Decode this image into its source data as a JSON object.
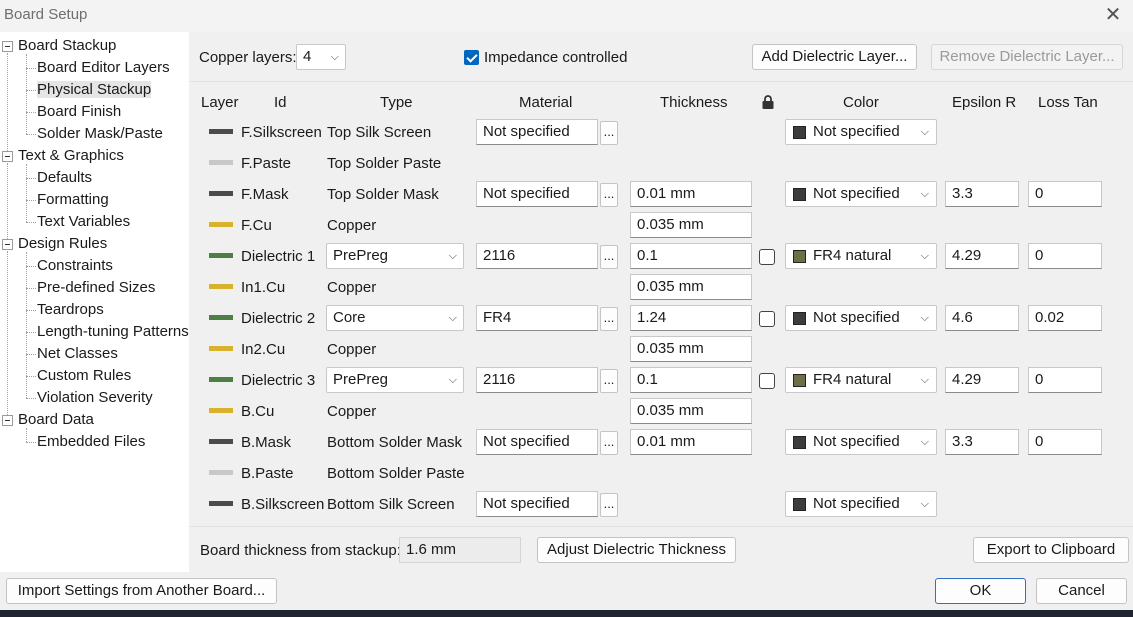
{
  "window": {
    "title": "Board Setup",
    "close_glyph": "✕"
  },
  "tree": {
    "groups": [
      {
        "label": "Board Stackup",
        "children": [
          "Board Editor Layers",
          "Physical Stackup",
          "Board Finish",
          "Solder Mask/Paste"
        ]
      },
      {
        "label": "Text & Graphics",
        "children": [
          "Defaults",
          "Formatting",
          "Text Variables"
        ]
      },
      {
        "label": "Design Rules",
        "children": [
          "Constraints",
          "Pre-defined Sizes",
          "Teardrops",
          "Length-tuning Patterns",
          "Net Classes",
          "Custom Rules",
          "Violation Severity"
        ]
      },
      {
        "label": "Board Data",
        "children": [
          "Embedded Files"
        ]
      }
    ],
    "selected": "Physical Stackup"
  },
  "toolbar": {
    "copper_layers_label": "Copper layers:",
    "copper_layers_value": "4",
    "impedance_label": "Impedance controlled",
    "impedance_checked": true,
    "add_dielectric": "Add Dielectric Layer...",
    "remove_dielectric": "Remove Dielectric Layer..."
  },
  "columns": {
    "layer": "Layer",
    "id": "Id",
    "type": "Type",
    "material": "Material",
    "thickness": "Thickness",
    "lock_icon": "lock-icon",
    "color": "Color",
    "epsilon": "Epsilon R",
    "loss": "Loss Tan"
  },
  "colors": {
    "silk": "#4b4b4b",
    "paste": "#c8c8c8",
    "mask": "#4b4b4b",
    "copper": "#d8b22a",
    "dielectric": "#4f7e45",
    "not_specified_swatch": "#3c3c3c",
    "fr4_swatch": "#6f6f45"
  },
  "rows": [
    {
      "swatch": "silk",
      "id": "F.Silkscreen",
      "type": "Top Silk Screen",
      "type_combo": false,
      "material": "Not specified",
      "thickness": "",
      "lock": false,
      "color": "Not specified",
      "color_swatch": "not_specified_swatch",
      "epsilon": "",
      "loss": ""
    },
    {
      "swatch": "paste",
      "id": "F.Paste",
      "type": "Top Solder Paste",
      "type_combo": false,
      "material": "",
      "thickness": "",
      "lock": false,
      "color": "",
      "color_swatch": "",
      "epsilon": "",
      "loss": ""
    },
    {
      "swatch": "mask",
      "id": "F.Mask",
      "type": "Top Solder Mask",
      "type_combo": false,
      "material": "Not specified",
      "thickness": "0.01 mm",
      "lock": false,
      "color": "Not specified",
      "color_swatch": "not_specified_swatch",
      "epsilon": "3.3",
      "loss": "0"
    },
    {
      "swatch": "copper",
      "id": "F.Cu",
      "type": "Copper",
      "type_combo": false,
      "material": "",
      "thickness": "0.035 mm",
      "lock": false,
      "color": "",
      "color_swatch": "",
      "epsilon": "",
      "loss": ""
    },
    {
      "swatch": "dielectric",
      "id": "Dielectric 1",
      "type": "PrePreg",
      "type_combo": true,
      "material": "2116",
      "thickness": "0.1",
      "lock": true,
      "color": "FR4 natural",
      "color_swatch": "fr4_swatch",
      "epsilon": "4.29",
      "loss": "0"
    },
    {
      "swatch": "copper",
      "id": "In1.Cu",
      "type": "Copper",
      "type_combo": false,
      "material": "",
      "thickness": "0.035 mm",
      "lock": false,
      "color": "",
      "color_swatch": "",
      "epsilon": "",
      "loss": ""
    },
    {
      "swatch": "dielectric",
      "id": "Dielectric 2",
      "type": "Core",
      "type_combo": true,
      "material": "FR4",
      "thickness": "1.24",
      "lock": true,
      "color": "Not specified",
      "color_swatch": "not_specified_swatch",
      "epsilon": "4.6",
      "loss": "0.02"
    },
    {
      "swatch": "copper",
      "id": "In2.Cu",
      "type": "Copper",
      "type_combo": false,
      "material": "",
      "thickness": "0.035 mm",
      "lock": false,
      "color": "",
      "color_swatch": "",
      "epsilon": "",
      "loss": ""
    },
    {
      "swatch": "dielectric",
      "id": "Dielectric 3",
      "type": "PrePreg",
      "type_combo": true,
      "material": "2116",
      "thickness": "0.1",
      "lock": true,
      "color": "FR4 natural",
      "color_swatch": "fr4_swatch",
      "epsilon": "4.29",
      "loss": "0"
    },
    {
      "swatch": "copper",
      "id": "B.Cu",
      "type": "Copper",
      "type_combo": false,
      "material": "",
      "thickness": "0.035 mm",
      "lock": false,
      "color": "",
      "color_swatch": "",
      "epsilon": "",
      "loss": ""
    },
    {
      "swatch": "mask",
      "id": "B.Mask",
      "type": "Bottom Solder Mask",
      "type_combo": false,
      "material": "Not specified",
      "thickness": "0.01 mm",
      "lock": false,
      "color": "Not specified",
      "color_swatch": "not_specified_swatch",
      "epsilon": "3.3",
      "loss": "0"
    },
    {
      "swatch": "paste",
      "id": "B.Paste",
      "type": "Bottom Solder Paste",
      "type_combo": false,
      "material": "",
      "thickness": "",
      "lock": false,
      "color": "",
      "color_swatch": "",
      "epsilon": "",
      "loss": ""
    },
    {
      "swatch": "silk",
      "id": "B.Silkscreen",
      "type": "Bottom Silk Screen",
      "type_combo": false,
      "material": "Not specified",
      "thickness": "",
      "lock": false,
      "color": "Not specified",
      "color_swatch": "not_specified_swatch",
      "epsilon": "",
      "loss": ""
    }
  ],
  "ellipsis": "...",
  "footer": {
    "thickness_label": "Board thickness from stackup:",
    "thickness_value": "1.6 mm",
    "adjust_button": "Adjust Dielectric Thickness",
    "export_button": "Export to Clipboard"
  },
  "dialog_buttons": {
    "import": "Import Settings from Another Board...",
    "ok": "OK",
    "cancel": "Cancel"
  }
}
